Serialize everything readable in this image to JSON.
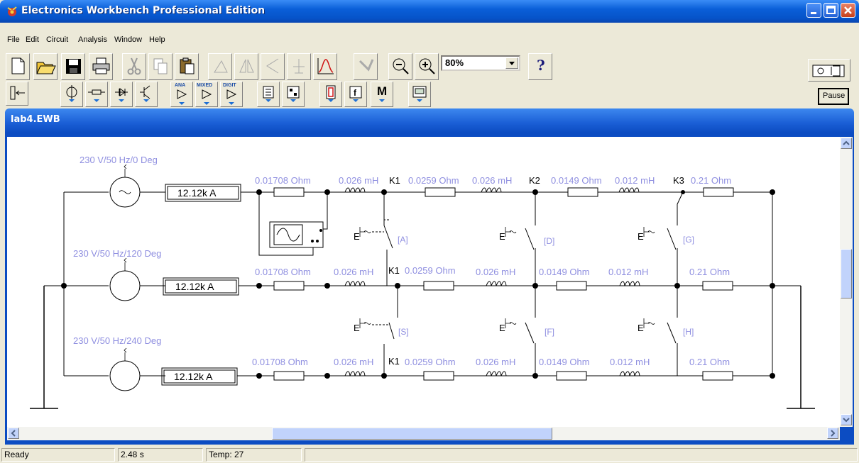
{
  "window": {
    "title": "Electronics Workbench Professional Edition"
  },
  "menu": [
    {
      "label": "File"
    },
    {
      "label": "Edit"
    },
    {
      "label": "Circuit"
    },
    {
      "label": "Analysis"
    },
    {
      "label": "Window"
    },
    {
      "label": "Help"
    }
  ],
  "toolbar": {
    "zoom_value": "80%",
    "help_label": "?"
  },
  "parts_bin": {
    "ana": "ANA",
    "mixed": "MIXED",
    "digit": "DIGIT",
    "misc_m": "M"
  },
  "sim": {
    "pause_label": "Pause"
  },
  "document": {
    "title": "lab4.EWB"
  },
  "circuit": {
    "sources": [
      "230 V/50 Hz/0 Deg",
      "230 V/50 Hz/120 Deg",
      "230 V/50 Hz/240 Deg"
    ],
    "ammeter_value": "12.12k A",
    "row1": [
      "0.01708  Ohm",
      "0.026 mH",
      "K1",
      "0.0259  Ohm",
      "0.026 mH",
      "K2",
      "0.0149  Ohm",
      "0.012 mH",
      "K3",
      "0.21  Ohm"
    ],
    "row2": [
      "0.01708  Ohm",
      "0.026 mH",
      "K1",
      "0.0259  Ohm",
      "0.026 mH",
      "0.0149  Ohm",
      "0.012 mH",
      "0.21  Ohm"
    ],
    "row3": [
      "0.01708  Ohm",
      "0.026 mH",
      "K1",
      "0.0259  Ohm",
      "0.026 mH",
      "0.0149  Ohm",
      "0.012 mH",
      "0.21  Ohm"
    ],
    "switch_labels": [
      "[A]",
      "[D]",
      "[G]",
      "[S]",
      "[F]",
      "[H]"
    ]
  },
  "status": {
    "state": "Ready",
    "time": "2.48 s",
    "temp": "Temp: 27"
  }
}
